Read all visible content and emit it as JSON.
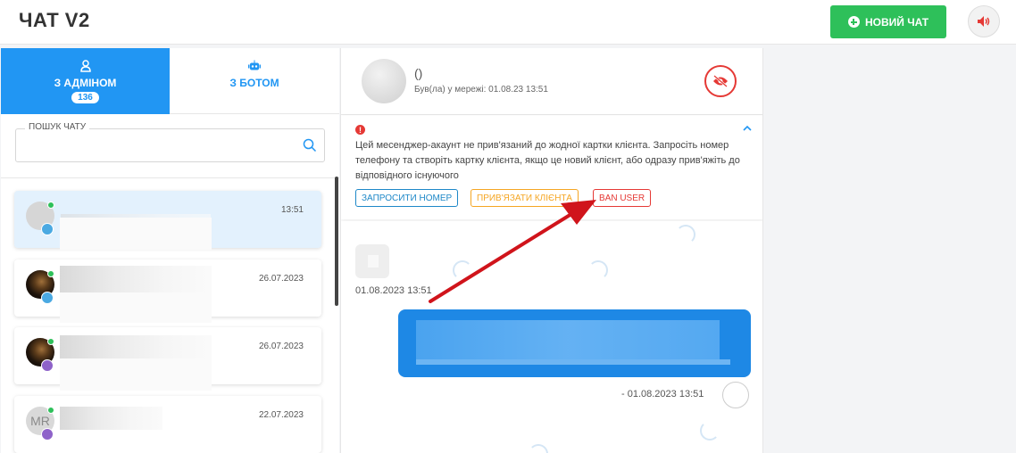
{
  "header": {
    "title": "ЧАТ V2",
    "new_chat_label": "НОВИЙ ЧАТ"
  },
  "tabs": [
    {
      "label": "З АДМІНОМ",
      "badge": "136",
      "active": true
    },
    {
      "label": "З БОТОМ",
      "active": false
    }
  ],
  "search": {
    "label": "ПОШУК ЧАТУ",
    "value": ""
  },
  "chats": [
    {
      "time": "13:51",
      "platform": "telegram",
      "online": true,
      "active": true
    },
    {
      "time": "26.07.2023",
      "platform": "telegram",
      "online": true,
      "active": false
    },
    {
      "time": "26.07.2023",
      "platform": "viber",
      "online": true,
      "active": false
    },
    {
      "time": "22.07.2023",
      "platform": "viber",
      "online": true,
      "active": false,
      "initials": "MR"
    }
  ],
  "contact": {
    "name": "()",
    "status": "Був(ла) у мережі: 01.08.23 13:51"
  },
  "warning": {
    "text": "Цей месенджер-акаунт не прив'язаний до жодної картки клієнта. Запросіть номер телефону та створіть картку клієнта, якщо це новий клієнт, або одразу прив'яжіть до відповідного існуючого",
    "request_number_label": "ЗАПРОСИТИ НОМЕР",
    "link_client_label": "ПРИВ'ЯЗАТИ КЛІЄНТА",
    "ban_user_label": "BAN USER"
  },
  "messages": [
    {
      "direction": "incoming",
      "time": "01.08.2023 13:51"
    },
    {
      "direction": "outgoing",
      "time": "-  01.08.2023 13:51"
    }
  ],
  "colors": {
    "accent": "#2196f3",
    "green": "#2ec05a",
    "danger": "#e53935",
    "warning": "#f5a623",
    "request": "#1e88c8",
    "annotation_arrow": "#d0141b"
  },
  "icons": {
    "new_chat": "plus-circle-icon",
    "sound": "speaker-icon",
    "admin_tab": "user-icon",
    "bot_tab": "robot-icon",
    "search": "search-icon",
    "ban": "eye-off-icon",
    "warning": "exclamation-icon",
    "collapse": "chevron-up-icon"
  }
}
